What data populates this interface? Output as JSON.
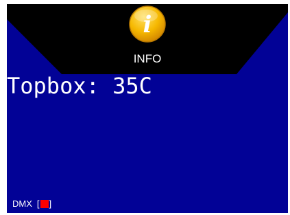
{
  "header": {
    "icon": "info-icon",
    "icon_glyph": "i",
    "label": "INFO"
  },
  "status": {
    "text": "Topbox: 35C"
  },
  "dmx": {
    "label": "DMX",
    "bracket_open": "[",
    "bracket_close": "]",
    "indicator_color": "#ff0000"
  },
  "colors": {
    "screen_background": "#020296",
    "header_band": "#000000",
    "icon_fill": "#f6b800",
    "text": "#ffffff"
  }
}
